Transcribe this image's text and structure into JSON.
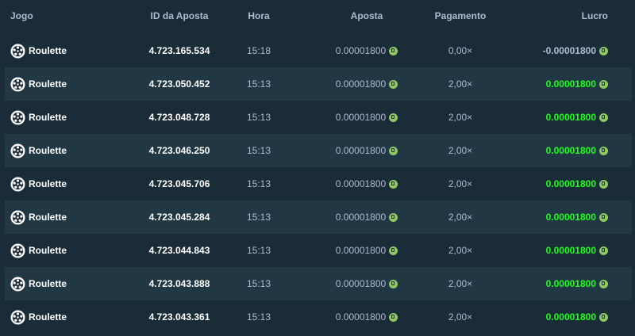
{
  "headers": {
    "game": "Jogo",
    "bet_id": "ID da Aposta",
    "time": "Hora",
    "bet": "Aposta",
    "payout": "Pagamento",
    "profit": "Lucro"
  },
  "colors": {
    "background": "#1a2c38",
    "striped_row": "#213743",
    "muted_text": "#b1bad3",
    "profit_positive": "#1fff20",
    "coin": "#90c964"
  },
  "rows": [
    {
      "game": "Roulette",
      "bet_id": "4.723.165.534",
      "time": "15:18",
      "bet": "0.00001800",
      "payout": "0,00×",
      "profit": "-0.00001800",
      "profit_positive": false
    },
    {
      "game": "Roulette",
      "bet_id": "4.723.050.452",
      "time": "15:13",
      "bet": "0.00001800",
      "payout": "2,00×",
      "profit": "0.00001800",
      "profit_positive": true
    },
    {
      "game": "Roulette",
      "bet_id": "4.723.048.728",
      "time": "15:13",
      "bet": "0.00001800",
      "payout": "2,00×",
      "profit": "0.00001800",
      "profit_positive": true
    },
    {
      "game": "Roulette",
      "bet_id": "4.723.046.250",
      "time": "15:13",
      "bet": "0.00001800",
      "payout": "2,00×",
      "profit": "0.00001800",
      "profit_positive": true
    },
    {
      "game": "Roulette",
      "bet_id": "4.723.045.706",
      "time": "15:13",
      "bet": "0.00001800",
      "payout": "2,00×",
      "profit": "0.00001800",
      "profit_positive": true
    },
    {
      "game": "Roulette",
      "bet_id": "4.723.045.284",
      "time": "15:13",
      "bet": "0.00001800",
      "payout": "2,00×",
      "profit": "0.00001800",
      "profit_positive": true
    },
    {
      "game": "Roulette",
      "bet_id": "4.723.044.843",
      "time": "15:13",
      "bet": "0.00001800",
      "payout": "2,00×",
      "profit": "0.00001800",
      "profit_positive": true
    },
    {
      "game": "Roulette",
      "bet_id": "4.723.043.888",
      "time": "15:13",
      "bet": "0.00001800",
      "payout": "2,00×",
      "profit": "0.00001800",
      "profit_positive": true
    },
    {
      "game": "Roulette",
      "bet_id": "4.723.043.361",
      "time": "15:13",
      "bet": "0.00001800",
      "payout": "2,00×",
      "profit": "0.00001800",
      "profit_positive": true
    }
  ]
}
